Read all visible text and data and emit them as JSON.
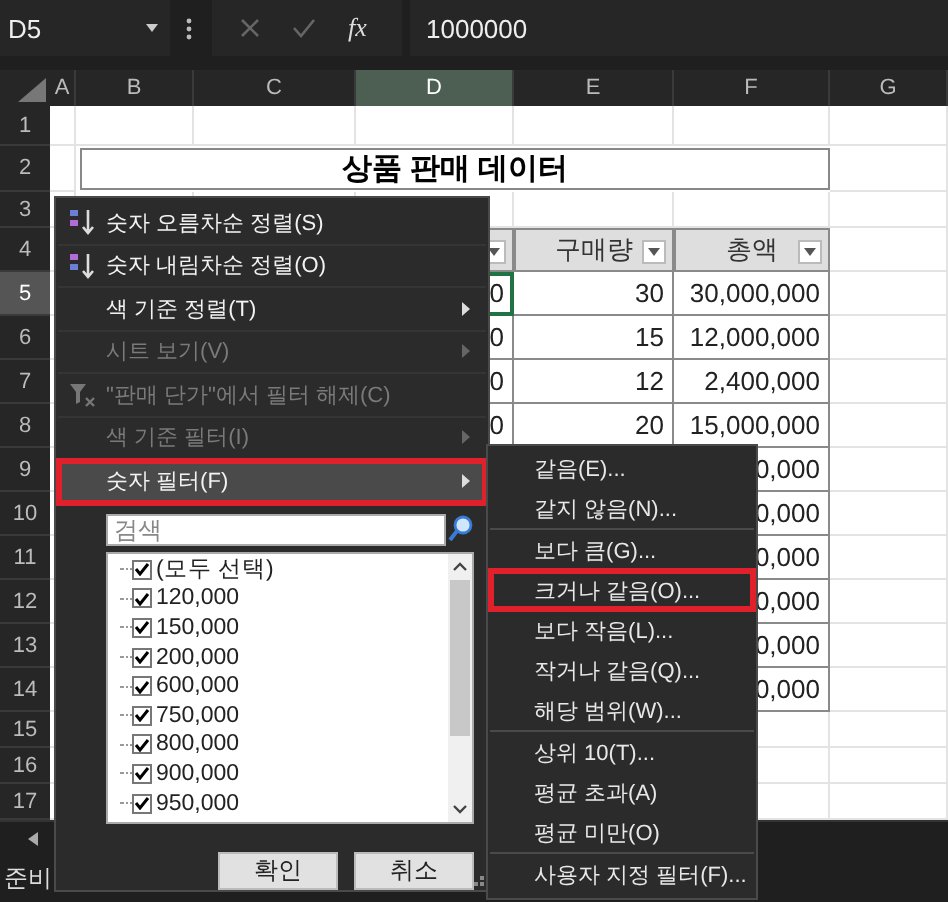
{
  "formula_bar": {
    "name_box": "D5",
    "function_label": "fx",
    "formula": "1000000"
  },
  "columns": [
    {
      "label": "A",
      "selected": false
    },
    {
      "label": "B",
      "selected": false
    },
    {
      "label": "C",
      "selected": false
    },
    {
      "label": "D",
      "selected": true
    },
    {
      "label": "E",
      "selected": false
    },
    {
      "label": "F",
      "selected": false
    },
    {
      "label": "G",
      "selected": false
    }
  ],
  "rows": [
    {
      "label": "1",
      "selected": false
    },
    {
      "label": "2",
      "selected": false
    },
    {
      "label": "3",
      "selected": false
    },
    {
      "label": "4",
      "selected": false
    },
    {
      "label": "5",
      "selected": true
    },
    {
      "label": "6",
      "selected": false
    },
    {
      "label": "7",
      "selected": false
    },
    {
      "label": "8",
      "selected": false
    },
    {
      "label": "9",
      "selected": false
    },
    {
      "label": "10",
      "selected": false
    },
    {
      "label": "11",
      "selected": false
    },
    {
      "label": "12",
      "selected": false
    },
    {
      "label": "13",
      "selected": false
    },
    {
      "label": "14",
      "selected": false
    },
    {
      "label": "15",
      "selected": false
    },
    {
      "label": "16",
      "selected": false
    },
    {
      "label": "17",
      "selected": false
    }
  ],
  "title": "상품 판매 데이터",
  "table": {
    "header": [
      {
        "filter": true
      },
      {
        "label": "구매량",
        "filter": true
      },
      {
        "label": "총액",
        "filter": true
      }
    ],
    "rows": [
      {
        "column_d": "0",
        "column_e": "30",
        "column_f": "30,000,000"
      },
      {
        "column_d": "0",
        "column_e": "15",
        "column_f": "12,000,000"
      },
      {
        "column_d": "0",
        "column_e": "12",
        "column_f": "2,400,000"
      },
      {
        "column_d": "0",
        "column_e": "20",
        "column_f": "15,000,000"
      },
      {
        "column_f": "0,000"
      },
      {
        "column_f": "0,000"
      },
      {
        "column_f": "0,000"
      },
      {
        "column_f": "0,000"
      },
      {
        "column_f": "0,000"
      },
      {
        "column_f": "0,000"
      }
    ]
  },
  "filter_menu": {
    "items": [
      {
        "kind": "sortup",
        "label": "숫자 오름차순 정렬(S)",
        "disabled": false,
        "submenu": false,
        "highlighted": false,
        "outlined": false
      },
      {
        "kind": "sortdown",
        "label": "숫자 내림차순 정렬(O)",
        "disabled": false,
        "submenu": false,
        "highlighted": false,
        "outlined": false
      },
      {
        "kind": "plain",
        "label": "색 기준 정렬(T)",
        "disabled": false,
        "submenu": true,
        "highlighted": false,
        "outlined": false
      },
      {
        "kind": "plain",
        "label": "시트 보기(V)",
        "disabled": true,
        "submenu": true,
        "highlighted": false,
        "outlined": false
      },
      {
        "kind": "clear",
        "label": "\"판매 단가\"에서 필터 해제(C)",
        "disabled": true,
        "submenu": false,
        "highlighted": false,
        "outlined": false
      },
      {
        "kind": "plain",
        "label": "색 기준 필터(I)",
        "disabled": true,
        "submenu": true,
        "highlighted": false,
        "outlined": false
      },
      {
        "kind": "plain",
        "label": "숫자 필터(F)",
        "disabled": false,
        "submenu": true,
        "highlighted": true,
        "outlined": true
      }
    ],
    "search": {
      "placeholder": "검색"
    },
    "values": [
      {
        "label": "(모두 선택)",
        "checked": true
      },
      {
        "label": "120,000",
        "checked": true
      },
      {
        "label": "150,000",
        "checked": true
      },
      {
        "label": "200,000",
        "checked": true
      },
      {
        "label": "600,000",
        "checked": true
      },
      {
        "label": "750,000",
        "checked": true
      },
      {
        "label": "800,000",
        "checked": true
      },
      {
        "label": "900,000",
        "checked": true
      },
      {
        "label": "950,000",
        "checked": true
      }
    ],
    "buttons": [
      "확인",
      "취소"
    ]
  },
  "number_filter_menu": {
    "items": [
      {
        "label": "같음(E)...",
        "separator_before": false,
        "outlined": false
      },
      {
        "label": "같지 않음(N)...",
        "separator_before": false,
        "outlined": false
      },
      {
        "label": "보다 큼(G)...",
        "separator_before": true,
        "outlined": false
      },
      {
        "label": "크거나 같음(O)...",
        "separator_before": false,
        "outlined": true
      },
      {
        "label": "보다 작음(L)...",
        "separator_before": false,
        "outlined": false
      },
      {
        "label": "작거나 같음(Q)...",
        "separator_before": false,
        "outlined": false
      },
      {
        "label": "해당 범위(W)...",
        "separator_before": false,
        "outlined": false
      },
      {
        "label": "상위 10(T)...",
        "separator_before": true,
        "outlined": false
      },
      {
        "label": "평균 초과(A)",
        "separator_before": false,
        "outlined": false
      },
      {
        "label": "평균 미만(O)",
        "separator_before": false,
        "outlined": false
      },
      {
        "label": "사용자 지정 필터(F)...",
        "separator_before": true,
        "outlined": false
      }
    ]
  },
  "status_bar": {
    "text": "준비"
  }
}
